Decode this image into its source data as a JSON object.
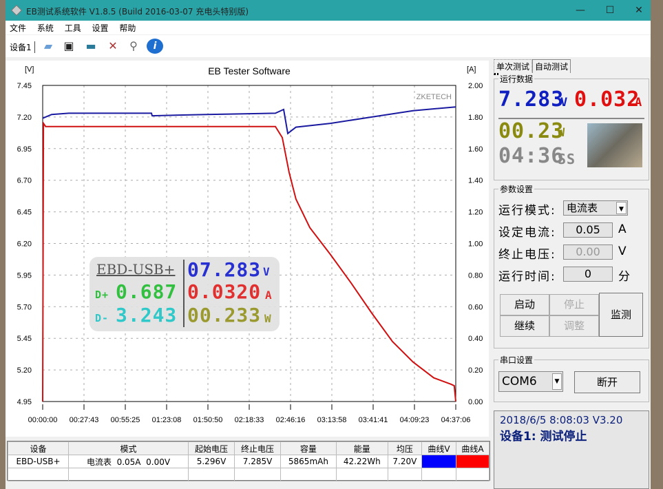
{
  "window": {
    "title": "EB测试系统软件 V1.8.5 (Build 2016-03-07 充电头特别版)",
    "minimize": "—",
    "maximize": "☐",
    "close": "✕"
  },
  "menu": [
    "文件",
    "系统",
    "工具",
    "设置",
    "帮助"
  ],
  "toolbar": {
    "device_tab": "设备1",
    "icons": [
      "folder-icon",
      "save-icon",
      "image-icon",
      "tools-icon",
      "search-icon",
      "info-icon"
    ]
  },
  "chart_data": {
    "type": "line",
    "title": "EB Tester Software",
    "watermark": "ZKETECH",
    "ylabel_left": "[V]",
    "ylabel_right": "[A]",
    "ylim_left": [
      4.95,
      7.45
    ],
    "ylim_right": [
      0,
      2.0
    ],
    "yticks_left": [
      "7.45",
      "7.20",
      "6.95",
      "6.70",
      "6.45",
      "6.20",
      "5.95",
      "5.70",
      "5.45",
      "5.20",
      "4.95"
    ],
    "yticks_right": [
      "2.00",
      "1.80",
      "1.60",
      "1.40",
      "1.20",
      "1.00",
      "0.80",
      "0.60",
      "0.40",
      "0.20",
      "0.00"
    ],
    "xticks": [
      "00:00:00",
      "00:27:43",
      "00:55:25",
      "01:23:08",
      "01:50:50",
      "02:18:33",
      "02:46:16",
      "03:13:58",
      "03:41:41",
      "04:09:23",
      "04:37:06"
    ],
    "grid": true,
    "series": [
      {
        "axis": "left",
        "color": "#1a1aa0",
        "x": [
          "00:00:00",
          "00:06:00",
          "00:17:33",
          "01:12:58",
          "01:13:25",
          "01:49:55",
          "02:36:05",
          "02:41:38",
          "02:44:24",
          "02:49:55",
          "03:13:02",
          "03:40:44",
          "04:08:26",
          "04:37:06"
        ],
        "y": [
          7.19,
          7.22,
          7.23,
          7.23,
          7.21,
          7.22,
          7.23,
          7.26,
          7.07,
          7.12,
          7.15,
          7.2,
          7.25,
          7.28
        ]
      },
      {
        "axis": "right",
        "color": "#d01010",
        "x": [
          "00:00:00",
          "00:00:30",
          "00:02:00",
          "02:36:05",
          "02:40:42",
          "02:45:18",
          "02:49:55",
          "02:59:12",
          "03:13:02",
          "03:26:54",
          "03:40:42",
          "03:54:36",
          "04:08:24",
          "04:22:18",
          "04:33:48",
          "04:36:06",
          "04:37:06"
        ],
        "y": [
          0,
          1.76,
          1.74,
          1.74,
          1.67,
          1.45,
          1.28,
          1.1,
          0.93,
          0.75,
          0.56,
          0.38,
          0.25,
          0.15,
          0.11,
          0.1,
          0
        ]
      }
    ]
  },
  "overlay": {
    "device": "EBD-USB+",
    "voltage": "07.283",
    "voltage_unit": "V",
    "current": "0.0320",
    "current_unit": "A",
    "power": "00.233",
    "power_unit": "W",
    "dplus_label": "D+",
    "dplus": "0.687",
    "dminus_label": "D-",
    "dminus": "3.243"
  },
  "table": {
    "headers": [
      "设备",
      "模式",
      "起始电压",
      "终止电压",
      "容量",
      "能量",
      "均压",
      "曲线V",
      "曲线A"
    ],
    "rows": [
      [
        "EBD-USB+",
        "电流表  0.05A  0.00V",
        "5.296V",
        "7.285V",
        "5865mAh",
        "42.22Wh",
        "7.20V",
        "",
        ""
      ]
    ],
    "curve_v_color": "#0000ff",
    "curve_a_color": "#ff0000"
  },
  "panel": {
    "tabs": [
      "单次测试",
      "自动测试"
    ],
    "running_label": "运行数据",
    "voltage": "7.283",
    "voltage_unit": "V",
    "current": "0.032",
    "current_unit": "A",
    "power": "00.23",
    "power_unit": "W",
    "time": "04:36",
    "time_unit": "SS",
    "params_label": "参数设置",
    "mode_label": "运行模式:",
    "mode_value": "电流表",
    "current_label": "设定电流:",
    "current_value": "0.05",
    "current_unit2": "A",
    "stopv_label": "终止电压:",
    "stopv_value": "0.00",
    "stopv_unit": "V",
    "runtime_label": "运行时间:",
    "runtime_value": "0",
    "runtime_unit": "分",
    "buttons": {
      "start": "启动",
      "stop": "停止",
      "continue": "继续",
      "adjust": "调整",
      "monitor": "监测"
    },
    "serial_label": "串口设置",
    "port": "COM6",
    "disconnect": "断开",
    "status_line1": "2018/6/5 8:08:03  V3.20",
    "status_line2": "设备1: 测试停止"
  }
}
